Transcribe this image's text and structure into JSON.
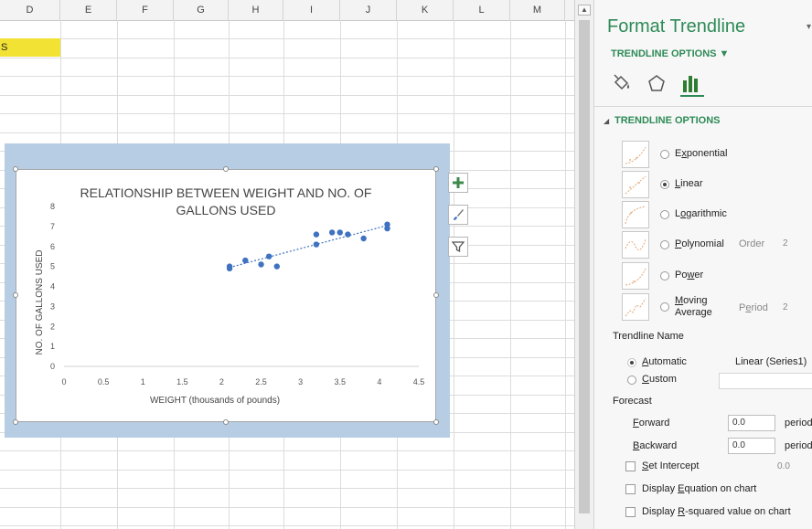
{
  "columns": [
    "D",
    "E",
    "F",
    "G",
    "H",
    "I",
    "J",
    "K",
    "L",
    "M"
  ],
  "cell_text": "S",
  "chart": {
    "title_line1": "RELATIONSHIP BETWEEN WEIGHT AND NO. OF",
    "title_line2": "GALLONS USED",
    "xlabel": "WEIGHT (thousands of pounds)",
    "ylabel": "NO. OF GALLONS USED"
  },
  "chart_data": {
    "type": "scatter",
    "title": "RELATIONSHIP BETWEEN WEIGHT AND NO. OF GALLONS USED",
    "xlabel": "WEIGHT (thousands of pounds)",
    "ylabel": "NO. OF GALLONS USED",
    "xlim": [
      0,
      4.5
    ],
    "ylim": [
      0,
      8
    ],
    "x_ticks": [
      "0",
      "0.5",
      "1",
      "1.5",
      "2",
      "2.5",
      "3",
      "3.5",
      "4",
      "4.5"
    ],
    "y_ticks": [
      "0",
      "1",
      "2",
      "3",
      "4",
      "5",
      "6",
      "7",
      "8"
    ],
    "grid": false,
    "trendline": "linear",
    "points": [
      {
        "x": 2.1,
        "y": 4.9
      },
      {
        "x": 2.1,
        "y": 5.0
      },
      {
        "x": 2.3,
        "y": 5.3
      },
      {
        "x": 2.5,
        "y": 5.1
      },
      {
        "x": 2.6,
        "y": 5.5
      },
      {
        "x": 2.7,
        "y": 5.0
      },
      {
        "x": 3.2,
        "y": 6.6
      },
      {
        "x": 3.2,
        "y": 6.1
      },
      {
        "x": 3.4,
        "y": 6.7
      },
      {
        "x": 3.5,
        "y": 6.7
      },
      {
        "x": 3.6,
        "y": 6.6
      },
      {
        "x": 3.8,
        "y": 6.4
      },
      {
        "x": 4.1,
        "y": 6.9
      },
      {
        "x": 4.1,
        "y": 7.1
      }
    ],
    "trend_line": {
      "x0": 2.1,
      "y0": 4.95,
      "x1": 4.1,
      "y1": 7.05
    },
    "colors": {
      "points": "#3f72c0",
      "trend": "#3f72c0",
      "background": "#b7cde3"
    }
  },
  "chart_tools": {
    "add_element": "plus-icon",
    "style": "brush-icon",
    "filter": "filter-icon"
  },
  "panel": {
    "title": "Format Trendline",
    "subtitle": "TRENDLINE OPTIONS ▼",
    "section": "TRENDLINE OPTIONS",
    "icons": [
      "paint-bucket-icon",
      "pentagon-icon",
      "bar-chart-icon"
    ],
    "types": [
      {
        "name": "Exponential",
        "underline": "x",
        "selected": false
      },
      {
        "name": "Linear",
        "underline": "L",
        "selected": true
      },
      {
        "name": "Logarithmic",
        "underline": "o",
        "selected": false
      },
      {
        "name": "Polynomial",
        "underline": "P",
        "selected": false,
        "extra_label": "Order",
        "extra_value": "2"
      },
      {
        "name": "Power",
        "underline": "w",
        "selected": false
      },
      {
        "name": "Moving Average",
        "line1": "Moving",
        "line2": "Average",
        "selected": false,
        "extra_label": "Period",
        "extra_value": "2"
      }
    ],
    "trendline_name_label": "Trendline Name",
    "automatic_label": "Automatic",
    "automatic_value": "Linear (Series1)",
    "custom_label": "Custom",
    "forecast_label": "Forecast",
    "forward_label": "Forward",
    "forward_value": "0.0",
    "backward_label": "Backward",
    "backward_value": "0.0",
    "period_unit": "periods",
    "set_intercept_label": "Set Intercept",
    "set_intercept_value": "0.0",
    "display_equation_label": "Display Equation on chart",
    "display_r2_label": "Display R-squared value on chart",
    "accent_color": "#2e8b57"
  }
}
